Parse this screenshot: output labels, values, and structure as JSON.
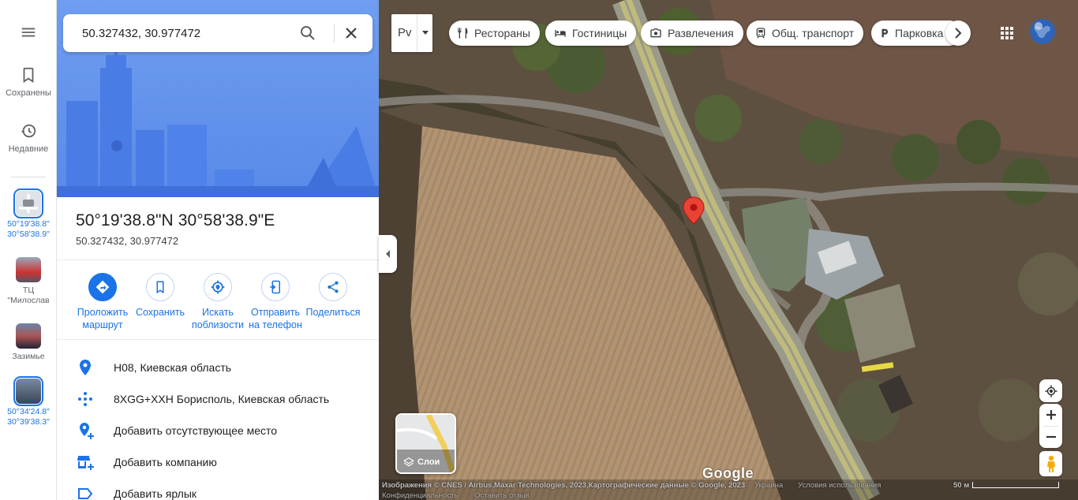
{
  "rail": {
    "menu_icon": "hamburger-menu-icon",
    "saved_label": "Сохранены",
    "recent_label": "Недавние",
    "recents": [
      {
        "line1": "50°19'38.8\"",
        "line2": "30°58'38.9\"",
        "icon": "map-thumbnail"
      },
      {
        "line1": "ТЦ",
        "line2": "\"Милослав",
        "icon": "place-thumbnail"
      },
      {
        "line1": "Зазимье",
        "line2": "",
        "icon": "place-thumbnail"
      },
      {
        "line1": "50°34'24.8\"",
        "line2": "30°39'38.3\"",
        "icon": "map-thumbnail"
      }
    ]
  },
  "search": {
    "value": "50.327432, 30.977472",
    "search_icon": "search-icon",
    "close_icon": "close-icon"
  },
  "place": {
    "title": "50°19'38.8\"N 30°58'38.9\"E",
    "coords": "50.327432, 30.977472"
  },
  "actions": [
    {
      "line1": "Проложить",
      "line2": "маршрут",
      "icon": "directions-icon"
    },
    {
      "line1": "Сохранить",
      "line2": "",
      "icon": "bookmark-icon"
    },
    {
      "line1": "Искать",
      "line2": "поблизости",
      "icon": "nearby-icon"
    },
    {
      "line1": "Отправить",
      "line2": "на телефон",
      "icon": "send-to-phone-icon"
    },
    {
      "line1": "Поделиться",
      "line2": "",
      "icon": "share-icon"
    }
  ],
  "info_rows": [
    {
      "text": "H08, Киевская область",
      "icon": "location-pin-icon"
    },
    {
      "text": "8XGG+XXH Борисполь, Киевская область",
      "icon": "plus-code-icon"
    },
    {
      "text": "Добавить отсутствующее место",
      "icon": "add-place-icon"
    },
    {
      "text": "Добавить компанию",
      "icon": "add-business-icon"
    },
    {
      "text": "Добавить ярлык",
      "icon": "label-icon"
    }
  ],
  "map": {
    "lang_label": "Рv",
    "chips": [
      {
        "label": "Рестораны",
        "icon": "restaurant-icon"
      },
      {
        "label": "Гостиницы",
        "icon": "hotel-icon"
      },
      {
        "label": "Развлечения",
        "icon": "camera-icon"
      },
      {
        "label": "Общ. транспорт",
        "icon": "transit-icon"
      },
      {
        "label": "Парковка",
        "icon": "parking-icon"
      }
    ],
    "layers_label": "Слои",
    "attribution": "Изображения © CNES / Airbus,Maxar Technologies, 2023,Картографические данные © Google, 2023",
    "region_link": "Украина",
    "terms_link": "Условия использования",
    "privacy_link": "Конфиденциальность",
    "feedback_link": "Оставить отзыв",
    "scale_label": "50 м",
    "logo_text": "Google",
    "marker_color": "#ea4335",
    "accent": "#1a73e8"
  }
}
